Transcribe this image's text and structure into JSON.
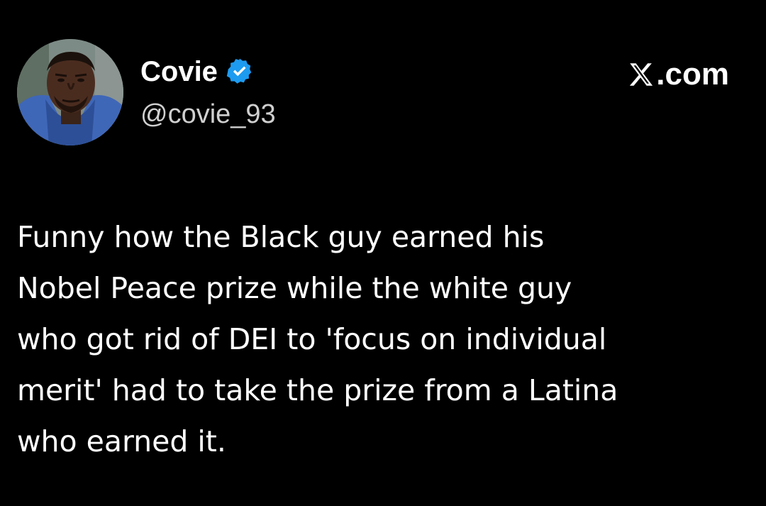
{
  "author": {
    "display_name": "Covie",
    "handle": "@covie_93",
    "verified": true,
    "avatar_icon": "profile-photo"
  },
  "site": {
    "label": ".com",
    "logo_icon": "x-logo-icon"
  },
  "tweet": {
    "lines": [
      "Funny how the Black guy earned his",
      "Nobel Peace prize while the white guy",
      "who got rid of DEI to 'focus on individual",
      "merit' had to take the prize from a Latina",
      "who earned it."
    ]
  },
  "colors": {
    "background": "#000000",
    "text": "#ffffff",
    "handle": "#d0d0d0",
    "verified_badge": "#1d9bf0"
  }
}
